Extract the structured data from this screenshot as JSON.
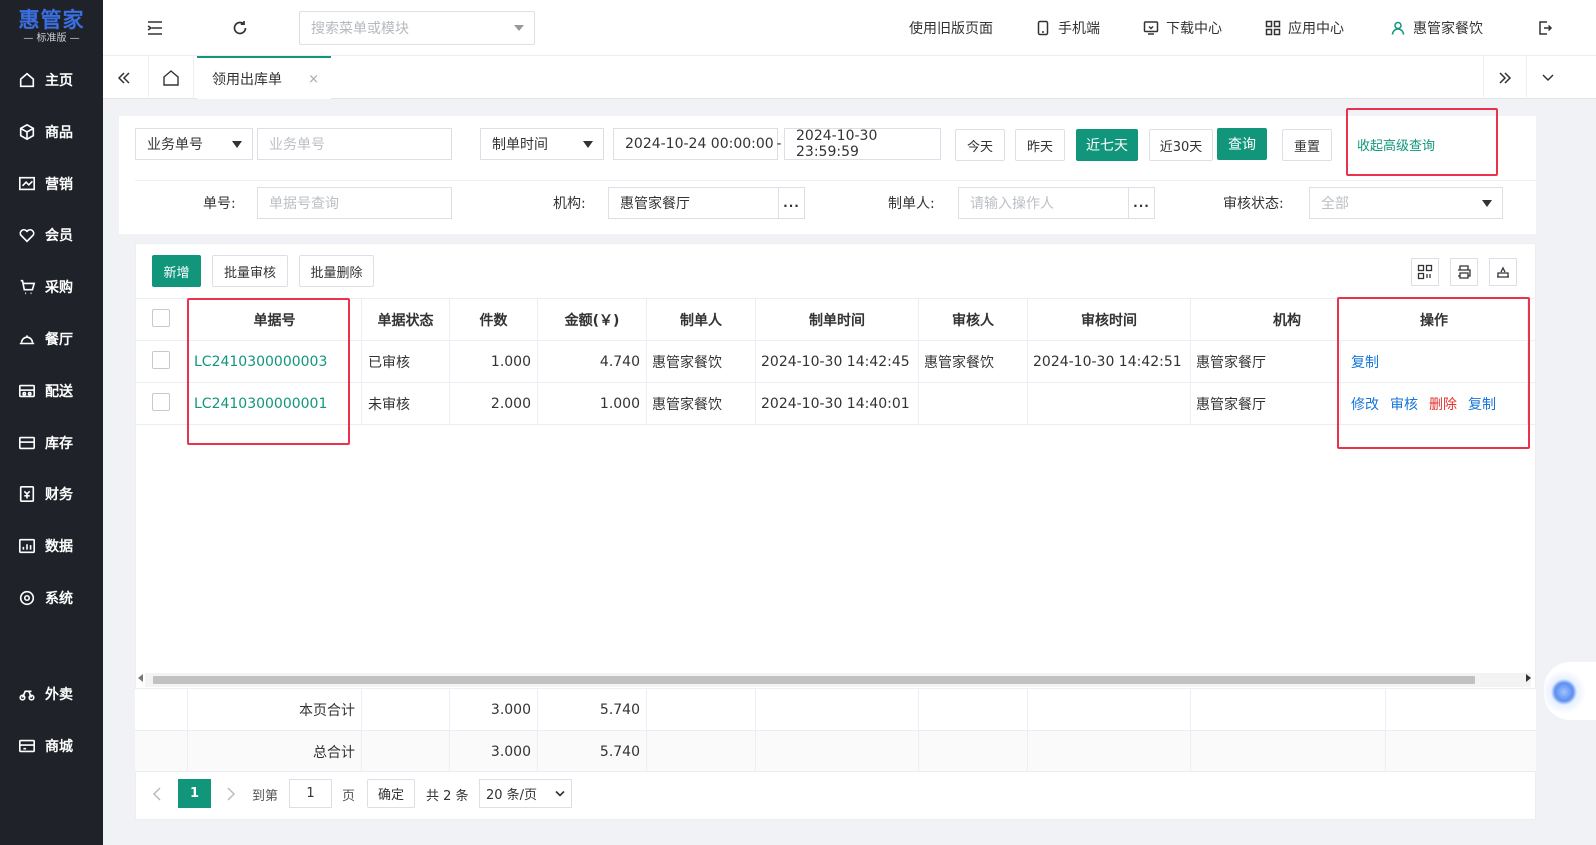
{
  "brand": {
    "name": "惠管家",
    "edition": "标准版"
  },
  "sidebar": {
    "items": [
      {
        "label": "主页",
        "icon": "home-icon"
      },
      {
        "label": "商品",
        "icon": "box-icon"
      },
      {
        "label": "营销",
        "icon": "chart-icon"
      },
      {
        "label": "会员",
        "icon": "heart-icon"
      },
      {
        "label": "采购",
        "icon": "purchase-icon"
      },
      {
        "label": "餐厅",
        "icon": "restaurant-icon"
      },
      {
        "label": "配送",
        "icon": "delivery-icon"
      },
      {
        "label": "库存",
        "icon": "inventory-icon"
      },
      {
        "label": "财务",
        "icon": "finance-icon"
      },
      {
        "label": "数据",
        "icon": "data-icon"
      },
      {
        "label": "系统",
        "icon": "settings-icon"
      },
      {
        "label": "外卖",
        "icon": "takeout-icon"
      },
      {
        "label": "商城",
        "icon": "mall-icon"
      }
    ]
  },
  "topbar": {
    "search_placeholder": "搜索菜单或模块",
    "old_page": "使用旧版页面",
    "mobile": "手机端",
    "download": "下载中心",
    "apps": "应用中心",
    "user": "惠管家餐饮"
  },
  "tabs": {
    "active": "领用出库单",
    "close": "×"
  },
  "filters": {
    "biz_select": "业务单号",
    "biz_placeholder": "业务单号",
    "time_select": "制单时间",
    "date_start": "2024-10-24 00:00:00",
    "date_sep": "-",
    "date_end": "2024-10-30 23:59:59",
    "quick": [
      "今天",
      "昨天",
      "近七天",
      "近30天"
    ],
    "query": "查询",
    "reset": "重置",
    "collapse": "收起高级查询",
    "no_label": "单号:",
    "no_placeholder": "单据号查询",
    "org_label": "机构:",
    "org_value": "惠管家餐厅",
    "maker_label": "制单人:",
    "maker_placeholder": "请输入操作人",
    "audit_label": "审核状态:",
    "audit_value": "全部",
    "dots": "..."
  },
  "toolbar": {
    "add": "新增",
    "batch_audit": "批量审核",
    "batch_delete": "批量删除"
  },
  "table": {
    "headers": [
      "单据号",
      "单据状态",
      "件数",
      "金额(￥)",
      "制单人",
      "制单时间",
      "审核人",
      "审核时间",
      "机构",
      "操作"
    ],
    "rows": [
      {
        "no": "LC2410300000003",
        "status": "已审核",
        "qty": "1.000",
        "amount": "4.740",
        "maker": "惠管家餐饮",
        "made_at": "2024-10-30 14:42:45",
        "auditor": "惠管家餐饮",
        "audited_at": "2024-10-30 14:42:51",
        "org": "惠管家餐厅",
        "ops": [
          "复制"
        ]
      },
      {
        "no": "LC2410300000001",
        "status": "未审核",
        "qty": "2.000",
        "amount": "1.000",
        "maker": "惠管家餐饮",
        "made_at": "2024-10-30 14:40:01",
        "auditor": "",
        "audited_at": "",
        "org": "惠管家餐厅",
        "ops": [
          "修改",
          "审核",
          "删除",
          "复制"
        ]
      }
    ],
    "page_total": {
      "label": "本页合计",
      "qty": "3.000",
      "amount": "5.740"
    },
    "grand_total": {
      "label": "总合计",
      "qty": "3.000",
      "amount": "5.740"
    }
  },
  "pagination": {
    "current": "1",
    "goto": "到第",
    "page_input": "1",
    "page_unit": "页",
    "confirm": "确定",
    "total": "共 2 条",
    "page_size": "20 条/页"
  },
  "colors": {
    "accent": "#12967b",
    "sidebar": "#1f2329",
    "link_blue": "#1677d8",
    "danger": "#e3312e",
    "highlight": "#e9334c"
  }
}
